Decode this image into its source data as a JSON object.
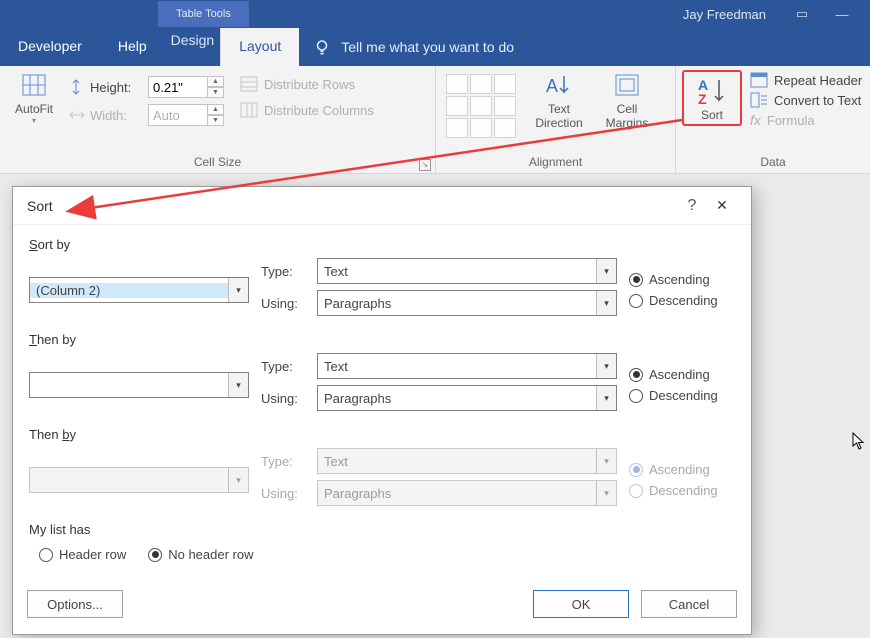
{
  "titlebar": {
    "context": "Table Tools",
    "user": "Jay Freedman"
  },
  "tabs": {
    "developer": "Developer",
    "help": "Help",
    "design": "Design",
    "layout": "Layout",
    "tellme": "Tell me what you want to do"
  },
  "ribbon": {
    "autofit": "AutoFit",
    "height_label": "Height:",
    "height_value": "0.21\"",
    "width_label": "Width:",
    "width_value": "Auto",
    "dist_rows": "Distribute Rows",
    "dist_cols": "Distribute Columns",
    "cell_size": "Cell Size",
    "text_direction": "Text\nDirection",
    "cell_margins": "Cell\nMargins",
    "align_label": "Alignment",
    "sort": "Sort",
    "repeat_header": "Repeat Header ",
    "convert_text": "Convert to Text",
    "formula": "Formula",
    "data_label": "Data"
  },
  "dialog": {
    "title": "Sort",
    "sort_by": "Sort by",
    "then_by": "Then by",
    "col_value": "(Column 2)",
    "type": "Type:",
    "using": "Using:",
    "type_val": "Text",
    "using_val": "Paragraphs",
    "asc": "Ascending",
    "desc": "Descending",
    "listhas": "My list has",
    "header_row": "Header row",
    "no_header": "No header row",
    "options": "Options...",
    "ok": "OK",
    "cancel": "Cancel"
  }
}
